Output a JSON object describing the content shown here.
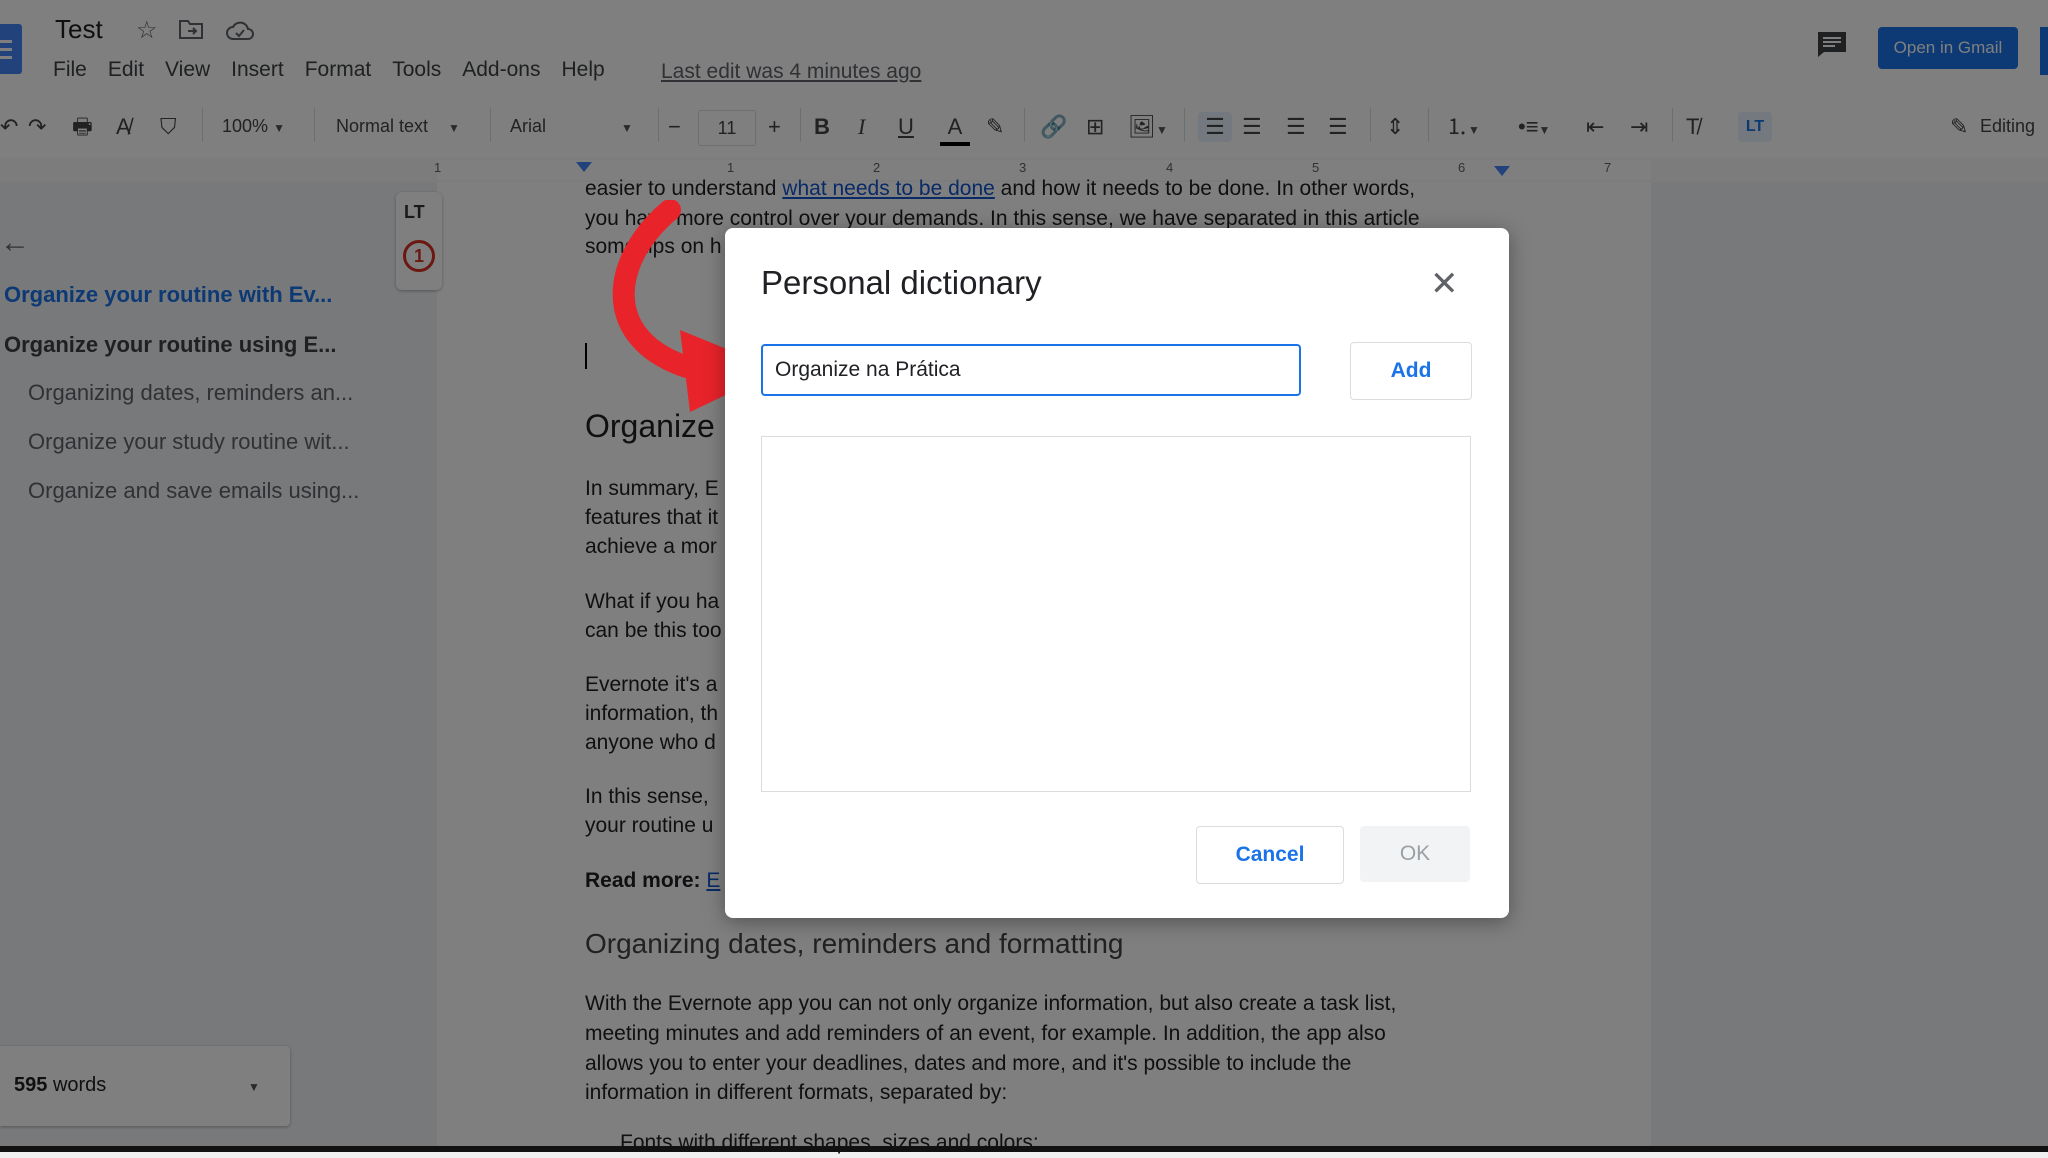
{
  "app": {
    "doc_title": "Test",
    "last_edit": "Last edit was 4 minutes ago",
    "open_in_gmail": "Open in Gmail",
    "accent_color": "#1a73e8"
  },
  "menu": [
    "File",
    "Edit",
    "View",
    "Insert",
    "Format",
    "Tools",
    "Add-ons",
    "Help"
  ],
  "toolbar": {
    "zoom": "100%",
    "style": "Normal text",
    "font": "Arial",
    "font_size": "11",
    "mode": "Editing"
  },
  "ruler": [
    "1",
    "1",
    "2",
    "3",
    "4",
    "5",
    "6",
    "7"
  ],
  "outline": {
    "items": [
      {
        "label": "Organize your routine with Ev...",
        "level": 1,
        "active": true
      },
      {
        "label": "Organize your routine using E...",
        "level": 1
      },
      {
        "label": "Organizing dates, reminders an...",
        "level": 2
      },
      {
        "label": "Organize your study routine wit...",
        "level": 2
      },
      {
        "label": "Organize and save emails using...",
        "level": 2
      }
    ]
  },
  "addon": {
    "badge": "1",
    "logo": "LT"
  },
  "word_count": {
    "count": "595",
    "unit": "words"
  },
  "document": {
    "line1_pre": "easier to understand ",
    "line1_link": "what needs to be done",
    "line1_post": " and how it needs to be done. In other words,",
    "line2": "you have more control over your demands. In this sense, we have separated in this article",
    "line3": "some tips on h",
    "heading1": "Organize",
    "p1": [
      "In summary, E",
      "features that it",
      "achieve a mor"
    ],
    "p2": [
      "What if you ha",
      "can be this too"
    ],
    "p3": [
      "Evernote it's a",
      "information, th",
      "anyone who d"
    ],
    "p4": [
      "In this sense, ",
      "your routine u"
    ],
    "read_more_label": "Read more: ",
    "read_more_link": "E",
    "heading2": "Organizing dates, reminders and formatting",
    "p5": [
      "With the Evernote app you can not only organize information, but also create a task list,",
      "meeting minutes and add reminders of an event, for example. In addition, the app also",
      "allows you to enter your deadlines, dates and more, and it's possible to include the",
      "information in different formats, separated by:"
    ],
    "bullet_partial": "Fonts with different shapes, sizes and colors;"
  },
  "dialog": {
    "title": "Personal dictionary",
    "input_value": "Organize na Prática",
    "add_label": "Add",
    "cancel_label": "Cancel",
    "ok_label": "OK"
  }
}
